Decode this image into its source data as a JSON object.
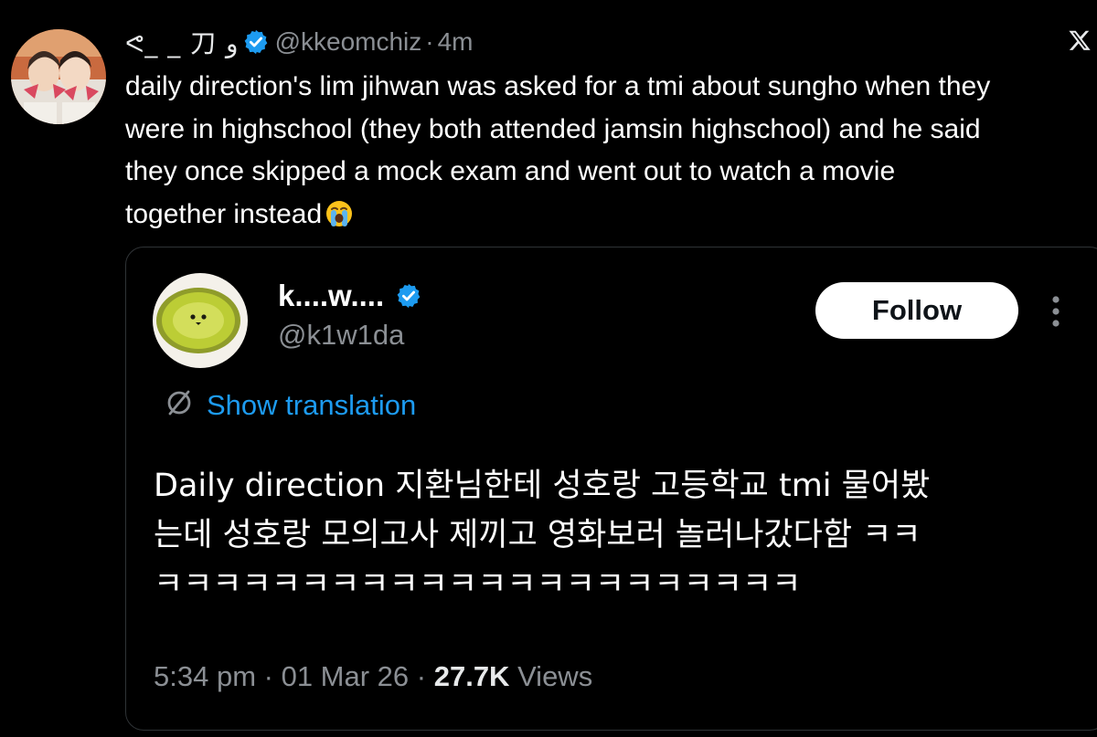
{
  "tweet": {
    "display_name": "ᕙ_ _ 刀 ﻭ",
    "handle": "@kkeomchiz",
    "separator": "·",
    "time": "4m",
    "text_lines": [
      "daily direction's lim jihwan was asked for a tmi about sungho when they",
      "were in highschool (they both attended jamsin highschool) and he said",
      "they once skipped a mock exam and went out to watch a movie",
      "together instead"
    ],
    "emoji": "loudly-crying-face"
  },
  "quote": {
    "display_name": "k....w....",
    "handle": "@k1w1da",
    "follow_label": "Follow",
    "translation_label": "Show translation",
    "text_lines": [
      "Daily direction 지환님한테 성호랑 고등학교 tmi 물어봤",
      "는데 성호랑 모의고사 제끼고 영화보러 놀러나갔다함 ㅋㅋ",
      "ㅋㅋㅋㅋㅋㅋㅋㅋㅋㅋㅋㅋㅋㅋㅋㅋㅋㅋㅋㅋㅋㅋ"
    ],
    "time": "5:34 pm",
    "separator1": " · ",
    "date": "01 Mar 26",
    "separator2": " · ",
    "views_count": "27.7K",
    "views_label": " Views"
  },
  "colors": {
    "background": "#000000",
    "text": "#ffffff",
    "secondary_text": "#8b8f94",
    "accent": "#1d9bf0",
    "border": "#2f3336"
  },
  "icons": {
    "verified": "verified-badge-icon",
    "x_logo": "x-logo-icon",
    "more": "more-vertical-icon",
    "translate": "translate-globe-icon"
  }
}
